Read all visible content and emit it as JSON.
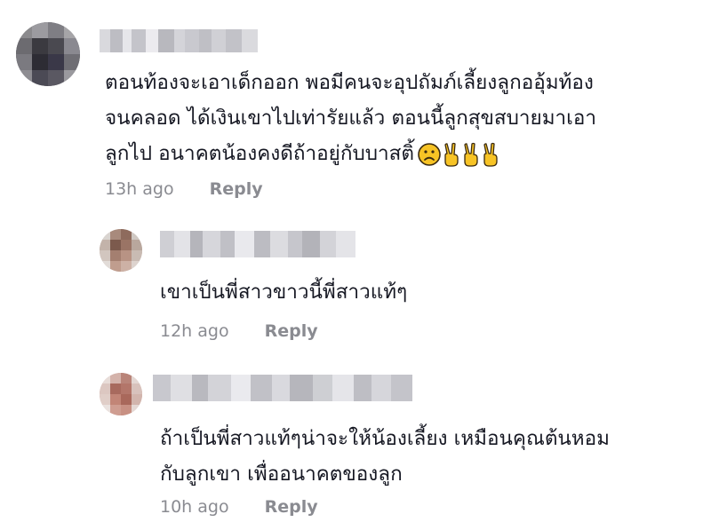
{
  "comments": [
    {
      "text_lines": [
        "ตอนท้องจะเอาเด็กออก พอมีคนจะอุปถัมภ์เลี้ยงลูกออุ้มท้อง",
        "จนคลอด ได้เงินเขาไปเท่ารัยแล้ว ตอนนี้ลูกสุขสบายมาเอา",
        "ลูกไป อนาคตน้องคงดีถ้าอยู่กับบาสติ้"
      ],
      "emojis": [
        "slightly-frowning-face-icon",
        "victory-hand-icon",
        "victory-hand-icon",
        "victory-hand-icon"
      ],
      "time": "13h ago",
      "reply": "Reply"
    },
    {
      "text_lines": [
        "เขาเป็นพี่สาวขาวนี้พี่สาวแท้ๆ"
      ],
      "time": "12h ago",
      "reply": "Reply"
    },
    {
      "text_lines": [
        "ถ้าเป็นพี่สาวแท้ๆน่าจะให้น้องเลี้ยง เหมือนคุณต้นหอม",
        "กับลูกเขา เพื่ออนาคตของลูก"
      ],
      "time": "10h ago",
      "reply": "Reply"
    }
  ],
  "colors": {
    "text": "#161823",
    "meta": "#8a8b91",
    "emoji_yellow": "#f7c325"
  }
}
